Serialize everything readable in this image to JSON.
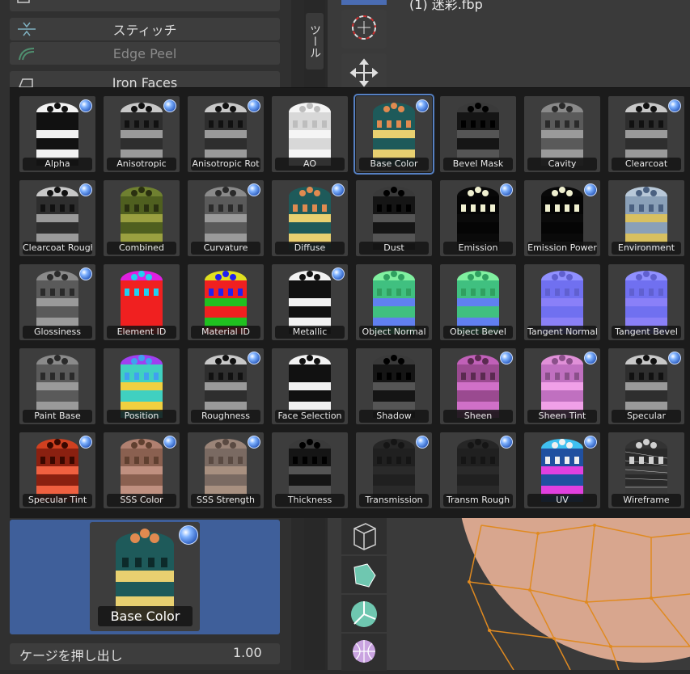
{
  "left_panel": {
    "tools": [
      {
        "label": "スティッチ",
        "icon": "stitch-icon",
        "dim": false
      },
      {
        "label": "Edge Peel",
        "icon": "edge-peel-icon",
        "dim": true
      },
      {
        "label": "Iron Faces",
        "icon": "iron-icon",
        "dim": false
      }
    ],
    "vertical_tab": "ツール",
    "selected_preview": {
      "label": "Base Color"
    },
    "cage": {
      "label": "ケージを押し出し",
      "value": "1.00"
    }
  },
  "viewport": {
    "title": "(1) 迷彩.fbp"
  },
  "matcap_grid": {
    "accent": "#4a7bd0",
    "items": [
      {
        "label": "Alpha",
        "badge": true,
        "style": "bw"
      },
      {
        "label": "Anisotropic",
        "badge": true,
        "style": "chrome"
      },
      {
        "label": "Anisotropic Rot",
        "badge": true,
        "style": "chrome"
      },
      {
        "label": "AO",
        "badge": false,
        "style": "white"
      },
      {
        "label": "Base Color",
        "badge": true,
        "style": "color",
        "selected": true
      },
      {
        "label": "Bevel Mask",
        "badge": false,
        "style": "dark"
      },
      {
        "label": "Cavity",
        "badge": false,
        "style": "grey"
      },
      {
        "label": "Clearcoat",
        "badge": true,
        "style": "chrome"
      },
      {
        "label": "Clearcoat Rough",
        "badge": true,
        "style": "chrome"
      },
      {
        "label": "Combined",
        "badge": false,
        "style": "camo"
      },
      {
        "label": "Curvature",
        "badge": true,
        "style": "grey"
      },
      {
        "label": "Diffuse",
        "badge": true,
        "style": "color"
      },
      {
        "label": "Dust",
        "badge": false,
        "style": "dark"
      },
      {
        "label": "Emission",
        "badge": true,
        "style": "emission"
      },
      {
        "label": "Emission Power",
        "badge": true,
        "style": "emission"
      },
      {
        "label": "Environment",
        "badge": false,
        "style": "env"
      },
      {
        "label": "Glossiness",
        "badge": true,
        "style": "grey"
      },
      {
        "label": "Element ID",
        "badge": false,
        "style": "elemid"
      },
      {
        "label": "Material ID",
        "badge": false,
        "style": "matid"
      },
      {
        "label": "Metallic",
        "badge": true,
        "style": "bw"
      },
      {
        "label": "Object Normal",
        "badge": false,
        "style": "normal"
      },
      {
        "label": "Object Bevel",
        "badge": false,
        "style": "normal"
      },
      {
        "label": "Tangent Normal",
        "badge": false,
        "style": "tangent"
      },
      {
        "label": "Tangent  Bevel",
        "badge": false,
        "style": "tangent"
      },
      {
        "label": "Paint Base",
        "badge": false,
        "style": "grey"
      },
      {
        "label": "Position",
        "badge": false,
        "style": "position"
      },
      {
        "label": "Roughness",
        "badge": true,
        "style": "chrome"
      },
      {
        "label": "Face Selection",
        "badge": false,
        "style": "bw"
      },
      {
        "label": "Shadow",
        "badge": false,
        "style": "dark"
      },
      {
        "label": "Sheen",
        "badge": true,
        "style": "pink"
      },
      {
        "label": "Sheen Tint",
        "badge": true,
        "style": "pinklight"
      },
      {
        "label": "Specular",
        "badge": true,
        "style": "chrome"
      },
      {
        "label": "Specular Tint",
        "badge": true,
        "style": "red"
      },
      {
        "label": "SSS Color",
        "badge": true,
        "style": "peach"
      },
      {
        "label": "SSS Strength",
        "badge": true,
        "style": "peachlight"
      },
      {
        "label": "Thickness",
        "badge": false,
        "style": "dark"
      },
      {
        "label": "Transmission",
        "badge": true,
        "style": "black"
      },
      {
        "label": "Transm Rough",
        "badge": true,
        "style": "black"
      },
      {
        "label": "UV",
        "badge": true,
        "style": "uv"
      },
      {
        "label": "Wireframe",
        "badge": false,
        "style": "wire"
      }
    ]
  }
}
